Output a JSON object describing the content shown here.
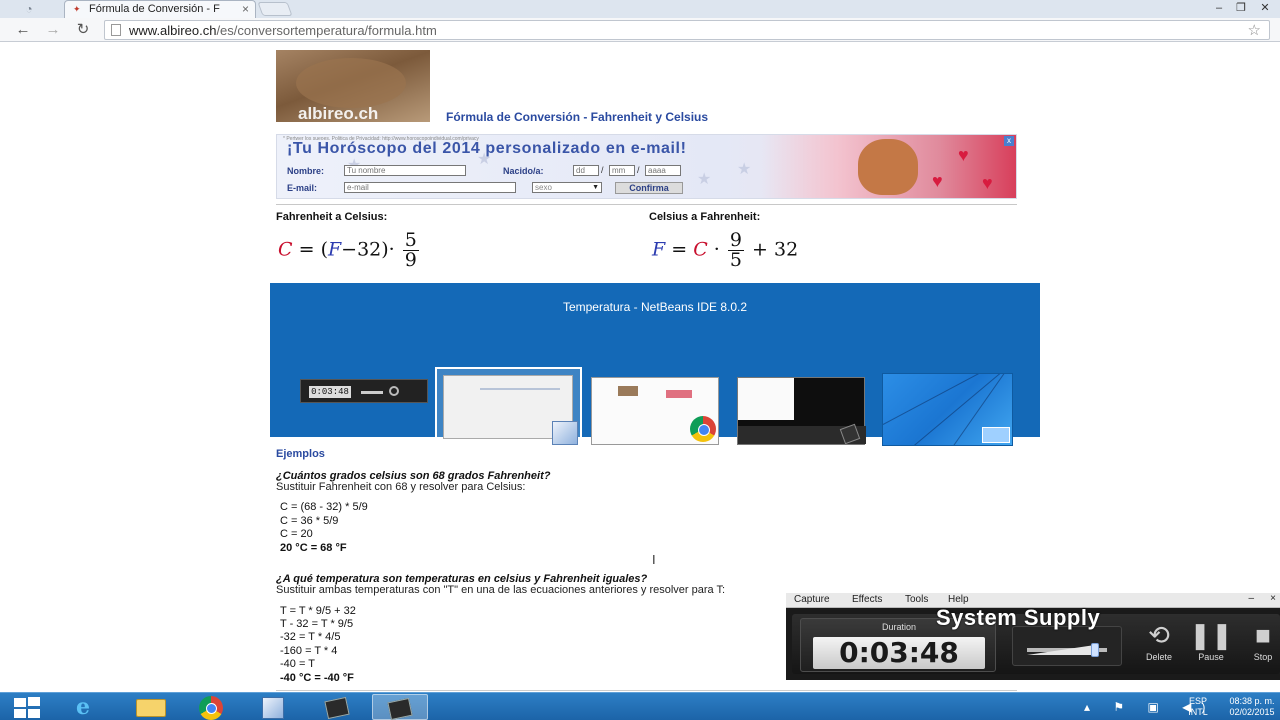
{
  "browser": {
    "tab_title": "Fórmula de Conversión - F",
    "url_domain": "www.albireo.ch",
    "url_path": "/es/conversortemperatura/formula.htm",
    "controls": {
      "back_icon": "←",
      "forward_icon": "→",
      "reload_icon": "↻",
      "bookmark_icon": "☆",
      "close_tab": "×",
      "minimize": "‒",
      "restore": "❐",
      "close": "✕"
    }
  },
  "page": {
    "logo_text": "albireo.ch",
    "title": "Fórmula de Conversión - Fahrenheit y Celsius",
    "ad": {
      "privacy": "* Pertwer los sueoes. Politica de Privacidad: http://www.horoscopoindividual.com/privacy",
      "headline": "¡Tu Horóscopo del 2014 personalizado en e-mail!",
      "name_label": "Nombre:",
      "name_placeholder": "Tu nombre",
      "born_label": "Nacido/a:",
      "day_placeholder": "dd",
      "month_placeholder": "mm",
      "year_placeholder": "aaaa",
      "separator": "/",
      "email_label": "E-mail:",
      "email_placeholder": "e-mail",
      "gender_placeholder": "sexo",
      "gender_arrow": "▼",
      "submit": "Confirma",
      "close_icon": "x"
    },
    "f_to_c_label": "Fahrenheit a Celsius:",
    "c_to_f_label": "Celsius a Fahrenheit:",
    "formula_f_to_c": {
      "lhs": "C",
      "eq": "=",
      "open_paren": "(",
      "f": "F",
      "minus_const": "−32)·",
      "num": "5",
      "den": "9"
    },
    "formula_c_to_f": {
      "lhs": "F",
      "eq": "=",
      "c": "C",
      "dot": "·",
      "num": "9",
      "den": "5",
      "plus_const": "+ 32"
    },
    "examples_heading": "Ejemplos",
    "example1": {
      "question": "¿Cuántos grados celsius son 68 grados Fahrenheit?",
      "instruction": "Sustituir Fahrenheit con 68 y resolver para Celsius:",
      "steps": [
        "C = (68 - 32) * 5/9",
        "C = 36 * 5/9",
        "C = 20"
      ],
      "result": "20 °C = 68 °F"
    },
    "example2": {
      "question": "¿A qué temperatura son temperaturas en celsius y Fahrenheit iguales?",
      "instruction": "Sustituir ambas temperaturas con \"T\" en una de las ecuaciones anteriores y resolver para T:",
      "steps": [
        "T = T * 9/5 + 32",
        "T - 32 = T * 9/5",
        "-32 = T * 4/5",
        "-160 = T * 4",
        "-40 = T"
      ],
      "result": "-40 °C = -40 °F"
    }
  },
  "alt_tab": {
    "title": "Temperatura - NetBeans IDE 8.0.2",
    "thumb1_duration": "0:03:48",
    "selected_index": 1
  },
  "recorder": {
    "menu": [
      "Capture",
      "Effects",
      "Tools",
      "Help"
    ],
    "minimize": "–",
    "close": "×",
    "duration_label": "Duration",
    "duration_value": "0:03:48",
    "volume_level": 0.85,
    "watermark": "System Supply",
    "buttons": [
      {
        "label": "Delete",
        "icon": "⟲"
      },
      {
        "label": "Pause",
        "icon": "❚❚"
      },
      {
        "label": "Stop",
        "icon": "■"
      }
    ]
  },
  "taskbar": {
    "apps": [
      "internet-explorer",
      "file-explorer",
      "chrome",
      "netbeans",
      "recorder",
      "recorder-2"
    ],
    "active_app": "recorder-2",
    "language": "ESP",
    "layout": "INTL",
    "time": "08:38 p. m.",
    "date": "02/02/2015",
    "tray_icons": "▴ ⚑ ▣ ◀)"
  },
  "colors": {
    "link_blue": "#2a4aa0",
    "formula_red": "#c8102e",
    "formula_blue": "#2b3bb0",
    "switcher_bg": "#1469b7",
    "taskbar_bg": "#1c64a8"
  }
}
